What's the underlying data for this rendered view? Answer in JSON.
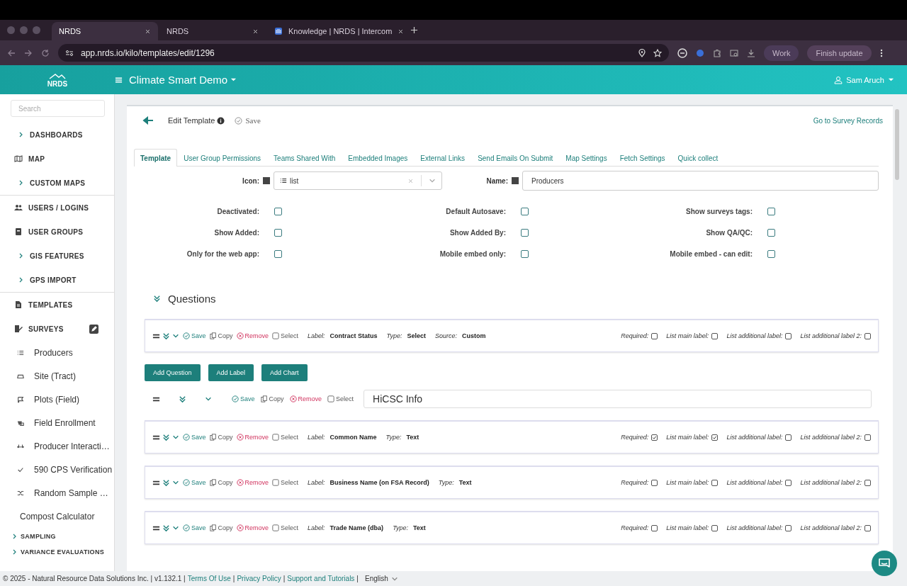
{
  "browser": {
    "tabs": [
      {
        "label": "NRDS",
        "selected": true
      },
      {
        "label": "NRDS",
        "selected": false
      },
      {
        "label": "Knowledge | NRDS | Intercom",
        "selected": false
      }
    ],
    "url": "app.nrds.io/kilo/templates/edit/1296",
    "profile": "Work",
    "update": "Finish update"
  },
  "header": {
    "logo": "NRDS",
    "title": "Climate Smart Demo",
    "user": "Sam Aruch"
  },
  "sidebar": {
    "search_placeholder": "Search",
    "items": [
      {
        "kind": "section",
        "label": "DASHBOARDS"
      },
      {
        "kind": "section",
        "label": "MAP"
      },
      {
        "kind": "section",
        "label": "CUSTOM MAPS"
      },
      {
        "kind": "section",
        "label": "USERS / LOGINS"
      },
      {
        "kind": "section",
        "label": "USER GROUPS"
      },
      {
        "kind": "section",
        "label": "GIS FEATURES"
      },
      {
        "kind": "section",
        "label": "GPS IMPORT"
      },
      {
        "kind": "section",
        "label": "TEMPLATES"
      },
      {
        "kind": "section",
        "label": "SURVEYS"
      },
      {
        "kind": "survey",
        "label": "Producers"
      },
      {
        "kind": "survey",
        "label": "Site (Tract)"
      },
      {
        "kind": "survey",
        "label": "Plots (Field)"
      },
      {
        "kind": "survey",
        "label": "Field Enrollment"
      },
      {
        "kind": "survey",
        "label": "Producer Interacti…"
      },
      {
        "kind": "survey",
        "label": "590 CPS Verification"
      },
      {
        "kind": "survey",
        "label": "Random Sample …"
      },
      {
        "kind": "plain",
        "label": "Compost Calculator"
      },
      {
        "kind": "group",
        "label": "SAMPLING"
      },
      {
        "kind": "group",
        "label": "VARIANCE EVALUATIONS"
      }
    ]
  },
  "page": {
    "title": "Edit Template",
    "save": "Save",
    "records_link": "Go to Survey Records",
    "tabs": [
      {
        "label": "Template",
        "selected": true
      },
      {
        "label": "User Group Permissions",
        "selected": false
      },
      {
        "label": "Teams Shared With",
        "selected": false
      },
      {
        "label": "Embedded Images",
        "selected": false
      },
      {
        "label": "External Links",
        "selected": false
      },
      {
        "label": "Send Emails On Submit",
        "selected": false
      },
      {
        "label": "Map Settings",
        "selected": false
      },
      {
        "label": "Fetch Settings",
        "selected": false
      },
      {
        "label": "Quick collect",
        "selected": false
      }
    ],
    "icon_label": "Icon:",
    "icon_value": "list",
    "name_label": "Name:",
    "name_value": "Producers",
    "settings": [
      {
        "label": "Deactivated:",
        "checked": false
      },
      {
        "label": "Default Autosave:",
        "checked": false
      },
      {
        "label": "Show surveys tags:",
        "checked": false
      },
      {
        "label": "Show Added:",
        "checked": false
      },
      {
        "label": "Show Added By:",
        "checked": false
      },
      {
        "label": "Show QA/QC:",
        "checked": false
      },
      {
        "label": "Only for the web app:",
        "checked": false
      },
      {
        "label": "Mobile embed only:",
        "checked": false
      },
      {
        "label": "Mobile embed - can edit:",
        "checked": false
      }
    ],
    "questions_heading": "Questions",
    "blocks": [
      {
        "kind": "question",
        "actions": [
          "Save",
          "Copy",
          "Remove",
          "Select"
        ],
        "fields": [
          {
            "name": "Label:",
            "value": "Contract Status"
          },
          {
            "name": "Type:",
            "value": "Select"
          },
          {
            "name": "Source:",
            "value": "Custom"
          }
        ],
        "flags": [
          {
            "label": "Required:",
            "checked": false
          },
          {
            "label": "List main label:",
            "checked": false
          },
          {
            "label": "List additional label:",
            "checked": false
          },
          {
            "label": "List additional label 2:",
            "checked": false
          }
        ]
      },
      {
        "kind": "buttons",
        "buttons": [
          "Add Question",
          "Add Label",
          "Add Chart"
        ]
      },
      {
        "kind": "label",
        "actions": [
          "Save",
          "Copy",
          "Remove",
          "Select"
        ],
        "value": "HiCSC Info"
      },
      {
        "kind": "question",
        "actions": [
          "Save",
          "Copy",
          "Remove",
          "Select"
        ],
        "fields": [
          {
            "name": "Label:",
            "value": "Common Name"
          },
          {
            "name": "Type:",
            "value": "Text"
          }
        ],
        "flags": [
          {
            "label": "Required:",
            "checked": true
          },
          {
            "label": "List main label:",
            "checked": true
          },
          {
            "label": "List additional label:",
            "checked": false
          },
          {
            "label": "List additional label 2:",
            "checked": false
          }
        ]
      },
      {
        "kind": "question",
        "actions": [
          "Save",
          "Copy",
          "Remove",
          "Select"
        ],
        "fields": [
          {
            "name": "Label:",
            "value": "Business Name (on FSA Record)"
          },
          {
            "name": "Type:",
            "value": "Text"
          }
        ],
        "flags": [
          {
            "label": "Required:",
            "checked": false
          },
          {
            "label": "List main label:",
            "checked": false
          },
          {
            "label": "List additional label:",
            "checked": false
          },
          {
            "label": "List additional label 2:",
            "checked": false
          }
        ]
      },
      {
        "kind": "question",
        "actions": [
          "Save",
          "Copy",
          "Remove",
          "Select"
        ],
        "fields": [
          {
            "name": "Label:",
            "value": "Trade Name (dba)"
          },
          {
            "name": "Type:",
            "value": "Text"
          }
        ],
        "flags": [
          {
            "label": "Required:",
            "checked": false
          },
          {
            "label": "List main label:",
            "checked": false
          },
          {
            "label": "List additional label:",
            "checked": false
          },
          {
            "label": "List additional label 2:",
            "checked": false
          }
        ]
      }
    ]
  },
  "footer": {
    "copyright": "© 2025 - Natural Resource Data Solutions Inc. | v1.132.1 |",
    "links": [
      {
        "label": "Terms Of Use",
        "separator": "|"
      },
      {
        "label": "Privacy Policy",
        "separator": "|"
      },
      {
        "label": "Support and Tutorials",
        "separator": "|"
      }
    ],
    "language": "English"
  }
}
